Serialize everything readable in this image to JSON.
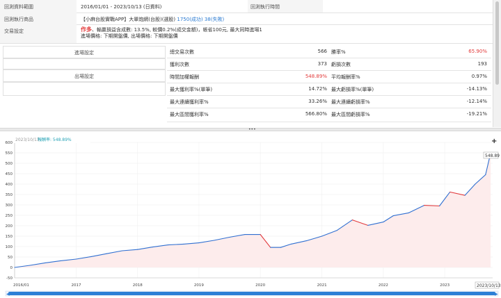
{
  "info": {
    "range_label": "回測資料範圍",
    "range_value": "2016/01/01 - 2023/10/13 (日資料)",
    "exec_time_label": "回測執行時間",
    "target_label": "回測執行商品",
    "target_prefix": "【小麻台股實戰APP】大單炮網(台股)(選股)",
    "target_success": "1750(成功)",
    "target_fail": "38(失敗)",
    "trade_label": "交易設定",
    "trade_side": "作多",
    "trade_line1": "、輸贏損益含成數: 13.5%, 較價0.2%(成交金額)，帳省100元, 最大同時進場1",
    "trade_line2": "進場價格: 下期開盤價, 出場價格: 下期開盤價"
  },
  "side": {
    "entry_label": "進場設定",
    "exit_label": "出場設定"
  },
  "stats": [
    {
      "l1": "總交易次數",
      "v1": "566",
      "l2": "勝率%",
      "v2": "65.90%",
      "v1_color": "",
      "v2_color": "red"
    },
    {
      "l1": "獲利次數",
      "v1": "373",
      "l2": "虧損次數",
      "v2": "193",
      "v1_color": "",
      "v2_color": ""
    },
    {
      "l1": "時間加權報酬",
      "v1": "548.89%",
      "l2": "平均報酬率%",
      "v2": "0.97%",
      "v1_color": "red",
      "v2_color": ""
    },
    {
      "l1": "最大獲利率%(單筆)",
      "v1": "14.72%",
      "l2": "最大虧損率%(單筆)",
      "v2": "-14.13%",
      "v1_color": "",
      "v2_color": ""
    },
    {
      "l1": "最大連續獲利率%",
      "v1": "33.26%",
      "l2": "最大連續虧損率%",
      "v2": "-12.14%",
      "v1_color": "",
      "v2_color": ""
    },
    {
      "l1": "最大區間獲利率%",
      "v1": "566.80%",
      "l2": "最大區間虧損率%",
      "v2": "-19.21%",
      "v1_color": "",
      "v2_color": ""
    }
  ],
  "legend": {
    "date": "2023/10/13",
    "label": "報酬率: 548.89%"
  },
  "zoom_plus": "+",
  "splitter_grip": "•••",
  "last_price": "548.89",
  "last_date": "2023/10/13",
  "colors": {
    "rise": "#2f6fd1",
    "fall": "#e2393c",
    "fill": "#fdecec",
    "scroll": "#2d7fd6"
  },
  "chart_data": {
    "type": "line",
    "title": "",
    "ylabel": "",
    "xlabel": "",
    "ylim": [
      -50,
      600
    ],
    "yticks": [
      -50,
      0,
      50,
      100,
      150,
      200,
      250,
      300,
      350,
      400,
      450,
      500,
      550,
      600
    ],
    "x_tick_labels": [
      "2016/01",
      "2017",
      "2018",
      "2019",
      "2020",
      "2021",
      "2022",
      "2023"
    ],
    "series": [
      {
        "name": "報酬率",
        "x": [
          "2016/01",
          "2016/04",
          "2016/07",
          "2016/10",
          "2017/01",
          "2017/04",
          "2017/07",
          "2017/10",
          "2018/01",
          "2018/04",
          "2018/07",
          "2018/10",
          "2019/01",
          "2019/04",
          "2019/07",
          "2019/10",
          "2020/01",
          "2020/03",
          "2020/05",
          "2020/07",
          "2020/10",
          "2021/01",
          "2021/04",
          "2021/07",
          "2021/10",
          "2022/01",
          "2022/03",
          "2022/06",
          "2022/09",
          "2022/12",
          "2023/02",
          "2023/05",
          "2023/07",
          "2023/09",
          "2023/10"
        ],
        "values": [
          0,
          10,
          22,
          32,
          40,
          52,
          66,
          80,
          86,
          98,
          108,
          112,
          118,
          130,
          145,
          158,
          158,
          96,
          96,
          112,
          128,
          150,
          178,
          228,
          202,
          218,
          248,
          262,
          298,
          295,
          362,
          346,
          400,
          445,
          549
        ]
      }
    ]
  }
}
